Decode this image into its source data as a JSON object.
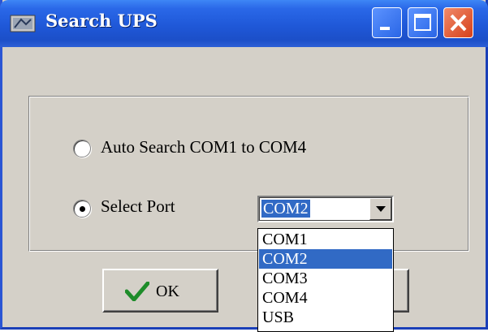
{
  "window": {
    "title": "Search UPS",
    "icon": "app-icon"
  },
  "titlebar_buttons": [
    "minimize-icon",
    "maximize-icon",
    "close-icon"
  ],
  "options": {
    "auto_search_label": "Auto Search COM1 to COM4",
    "select_port_label": "Select Port",
    "selected_option": "select_port"
  },
  "port_select": {
    "value": "COM2",
    "options": [
      "COM1",
      "COM2",
      "COM3",
      "COM4",
      "USB"
    ],
    "highlighted": "COM2"
  },
  "buttons": {
    "ok_label": "OK",
    "ok_icon": "checkmark-icon"
  },
  "colors": {
    "titlebar": "#1f58d8",
    "selection": "#316ac5",
    "dialog_bg": "#d4d0c8"
  }
}
